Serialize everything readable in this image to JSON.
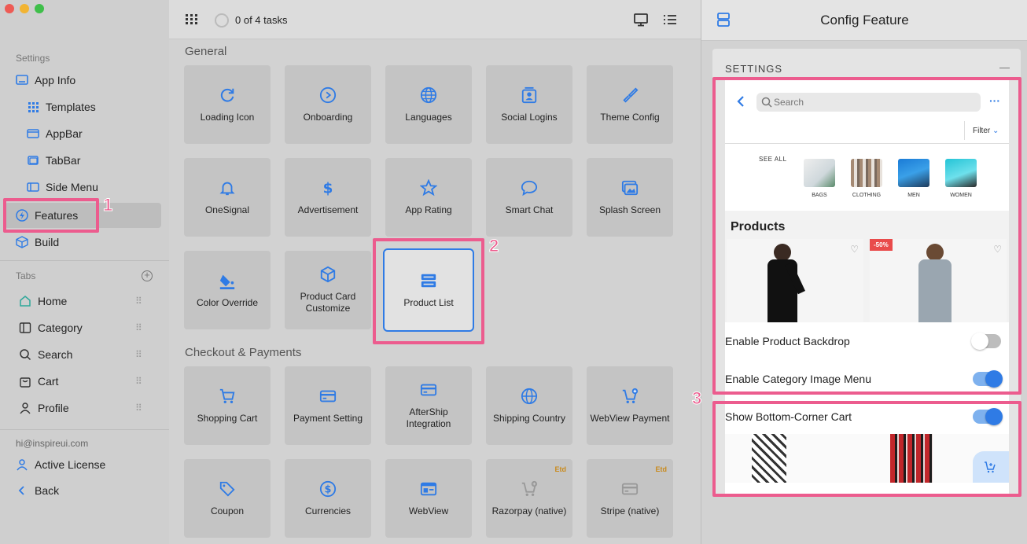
{
  "sidebar": {
    "settings_section": "Settings",
    "items": [
      {
        "label": "App Info"
      },
      {
        "label": "Templates"
      },
      {
        "label": "AppBar"
      },
      {
        "label": "TabBar"
      },
      {
        "label": "Side Menu"
      },
      {
        "label": "Features"
      },
      {
        "label": "Build"
      }
    ],
    "tabs_section": "Tabs",
    "tabs": [
      {
        "label": "Home"
      },
      {
        "label": "Category"
      },
      {
        "label": "Search"
      },
      {
        "label": "Cart"
      },
      {
        "label": "Profile"
      }
    ],
    "email": "hi@inspireui.com",
    "active_license": "Active License",
    "back": "Back"
  },
  "topbar": {
    "tasks": "0 of 4 tasks"
  },
  "main": {
    "general_title": "General",
    "general": [
      {
        "label": "Loading Icon",
        "icon": "refresh-icon"
      },
      {
        "label": "Onboarding",
        "icon": "play-circle-icon"
      },
      {
        "label": "Languages",
        "icon": "globe-icon"
      },
      {
        "label": "Social Logins",
        "icon": "user-card-icon"
      },
      {
        "label": "Theme Config",
        "icon": "brush-icon"
      },
      {
        "label": "OneSignal",
        "icon": "bell-icon"
      },
      {
        "label": "Advertisement",
        "icon": "dollar-icon"
      },
      {
        "label": "App Rating",
        "icon": "star-icon"
      },
      {
        "label": "Smart Chat",
        "icon": "chat-icon"
      },
      {
        "label": "Splash Screen",
        "icon": "image-icon"
      },
      {
        "label": "Color Override",
        "icon": "paint-bucket-icon"
      },
      {
        "label": "Product Card",
        "label2": "Customize",
        "icon": "cube-icon"
      },
      {
        "label": "Product List",
        "icon": "list-icon"
      }
    ],
    "checkout_title": "Checkout & Payments",
    "checkout": [
      {
        "label": "Shopping Cart",
        "icon": "cart-icon"
      },
      {
        "label": "Payment Setting",
        "icon": "card-icon"
      },
      {
        "label": "AfterShip",
        "label2": "Integration",
        "icon": "card-icon"
      },
      {
        "label": "Shipping Country",
        "icon": "globe-icon"
      },
      {
        "label": "WebView Payment",
        "icon": "cart-plus-icon"
      },
      {
        "label": "Coupon",
        "icon": "tag-icon"
      },
      {
        "label": "Currencies",
        "icon": "dollar-circle-icon"
      },
      {
        "label": "WebView",
        "icon": "webview-icon"
      },
      {
        "label": "Razorpay (native)",
        "icon": "cart-plus-icon",
        "badge": "Etd"
      },
      {
        "label": "Stripe (native)",
        "icon": "card-icon",
        "badge": "Etd"
      }
    ]
  },
  "panel": {
    "title": "Config Feature",
    "settings_label": "SETTINGS",
    "collapse": "—",
    "preview": {
      "search_placeholder": "Search",
      "filter": "Filter",
      "see_all": "SEE ALL",
      "categories": [
        "BAGS",
        "CLOTHING",
        "MEN",
        "WOMEN"
      ],
      "products_title": "Products",
      "discount": "-50%"
    },
    "toggles": [
      {
        "label": "Enable Product Backdrop",
        "on": false
      },
      {
        "label": "Enable Category Image Menu",
        "on": true
      },
      {
        "label": "Show Bottom-Corner Cart",
        "on": true
      }
    ]
  },
  "annotations": [
    "1",
    "2",
    "3"
  ],
  "colors": {
    "accent": "#2f7be5",
    "highlight": "#ec5c8e",
    "etd": "#c98a1c"
  }
}
